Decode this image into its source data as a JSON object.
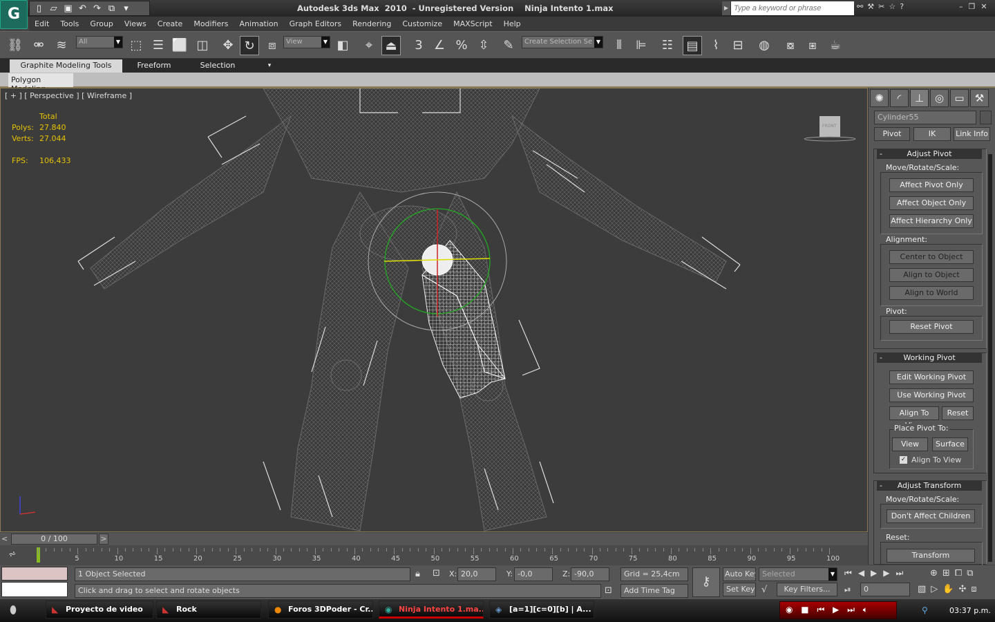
{
  "app": {
    "title": "Autodesk 3ds Max  2010  - Unregistered Version    Ninja Intento 1.max",
    "search_placeholder": "Type a keyword or phrase",
    "logo": "G"
  },
  "menu": [
    "Edit",
    "Tools",
    "Group",
    "Views",
    "Create",
    "Modifiers",
    "Animation",
    "Graph Editors",
    "Rendering",
    "Customize",
    "MAXScript",
    "Help"
  ],
  "toolbar": {
    "selection_filter": "All",
    "ref_coord": "View",
    "named_selection": "Create Selection Se",
    "snap_label": "3",
    "active_tool": "select-and-rotate"
  },
  "ribbon": {
    "tabs": [
      "Graphite Modeling Tools",
      "Freeform",
      "Selection"
    ],
    "panel": "Polygon Modeling"
  },
  "viewport": {
    "label": "[ + ] [ Perspective ] [ Wireframe ]",
    "stats": {
      "header": "Total",
      "polys_label": "Polys:",
      "polys": "27.840",
      "verts_label": "Verts:",
      "verts": "27.044",
      "fps_label": "FPS:",
      "fps": "106,433"
    },
    "viewcube": "FRONT"
  },
  "command_panel": {
    "object_name": "Cylinder55",
    "tabs": [
      "Pivot",
      "IK",
      "Link Info"
    ],
    "adjust_pivot": {
      "title": "Adjust Pivot",
      "move_group": "Move/Rotate/Scale:",
      "buttons": [
        "Affect Pivot Only",
        "Affect Object Only",
        "Affect Hierarchy Only"
      ],
      "alignment_group": "Alignment:",
      "alignment": [
        "Center to Object",
        "Align to Object",
        "Align to World"
      ],
      "pivot_group": "Pivot:",
      "reset_pivot": "Reset Pivot"
    },
    "working_pivot": {
      "title": "Working Pivot",
      "edit": "Edit Working Pivot",
      "use": "Use Working Pivot",
      "align_to_view": "Align To View",
      "reset": "Reset",
      "place_group": "Place Pivot To:",
      "view": "View",
      "surface": "Surface",
      "align_checkbox": "Align To View",
      "align_checked": true
    },
    "adjust_transform": {
      "title": "Adjust Transform",
      "move_group": "Move/Rotate/Scale:",
      "dont_affect": "Don't Affect Children",
      "reset_group": "Reset:",
      "transform": "Transform"
    }
  },
  "timeline": {
    "position": "0 / 100",
    "current": 0,
    "max": 100,
    "ticks": [
      "5",
      "10",
      "15",
      "20",
      "25",
      "30",
      "35",
      "40",
      "45",
      "50",
      "55",
      "60",
      "65",
      "70",
      "75",
      "80",
      "85",
      "90",
      "95",
      "100"
    ]
  },
  "status": {
    "selection": "1 Object Selected",
    "prompt": "Click and drag to select and rotate objects",
    "x_label": "X:",
    "x": "20,0",
    "y_label": "Y:",
    "y": "-0,0",
    "z_label": "Z:",
    "z": "-90,0",
    "grid": "Grid = 25,4cm",
    "add_time_tag": "Add Time Tag",
    "auto_key": "Auto Key",
    "set_key": "Set Key",
    "key_mode": "Selected",
    "key_filters": "Key Filters...",
    "frame": "0"
  },
  "taskbar": {
    "items": [
      "Proyecto de video",
      "Rock",
      "Foros 3DPoder - Cr...",
      "Ninja Intento 1.ma...",
      "[a=1][c=0][b] | A..."
    ],
    "active": 3,
    "clock": "03:37 p.m."
  },
  "colors": {
    "accent": "#e6c200",
    "viewport_bg": "#3c3c3c",
    "selected_wire": "#ffffff",
    "active_task": "#ff4444"
  }
}
